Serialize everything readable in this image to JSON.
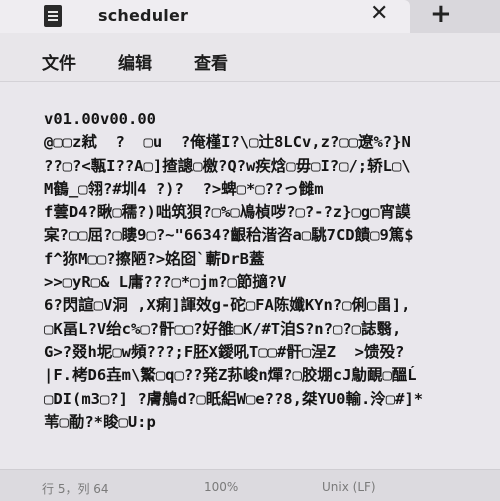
{
  "window": {
    "tab_title": "scheduler",
    "icons": {
      "app": "notepad-icon",
      "close": "close-icon",
      "new_tab": "plus-icon"
    },
    "close_glyph": "✕",
    "new_tab_glyph": "+"
  },
  "menu": {
    "items": [
      {
        "label": "文件"
      },
      {
        "label": "编辑"
      },
      {
        "label": "查看"
      }
    ]
  },
  "editor": {
    "lines": [
      "v01.00v00.00",
      "@▢▢z弒  ?  ▢u  ?俺槿I?\\▢辻8LCv,z?▢▢遼%?}N",
      "??▢?<甎I??A▢]揸謥▢檄?Q?w疾焓▢毋▢I?▢/;轿L▢\\",
      "M鶴_▢翎?#圳4 ?)?  ?>蜱▢*▢??っ雠m",
      "f蕓D4?瞅▢穤?)咄筑狽?▢%▢鳰楨哕?▢?-?z}▢g▢宵謨",
      "宲?▢▢屈?▢瞜9▢?~\"6634?齦秴湝咨a▢駣7CD饋▢9篤$",
      "f^狝M▢▢?擦陋?>姳囵`蘄DrB蓋",
      ">>▢yR▢& L庸???▢*▢jm?▢節擿?V",
      "6?閃諠▢V洞 ,X痢]諢效g-砣▢FA陈孅KYn?▢俐▢畕],",
      "▢K畐L?V绐c%▢?骭▢▢?好雒▢K/#T洎S?n?▢?▢誌翳,",
      "G>?叕h坭▢w頻???;F胚X鑀吼T▢▢#骭▢浧Z  >馈殁?",
      "|F.栲D6壵m\\鰵▢q▢??発Z荪峻n燀?▢胶堋cJ鳨靦▢醞Ĺ",
      "▢DI(m3▢?] ?膚鵃d?▢眂絽W▢e??8,桀YU0輸.泠▢#]*",
      "苇▢勈?*睃▢U:p"
    ]
  },
  "status": {
    "position": "行 5，列 64",
    "zoom": "100%",
    "eol": "Unix (LF)"
  }
}
